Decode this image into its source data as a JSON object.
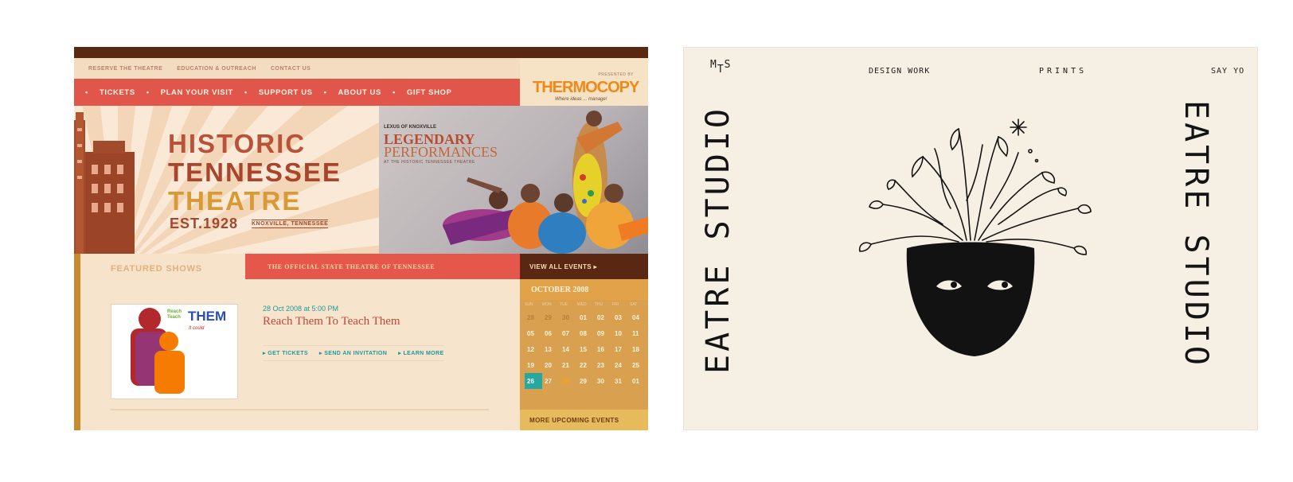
{
  "left_site": {
    "utility_links": [
      "RESERVE THE THEATRE",
      "EDUCATION & OUTREACH",
      "CONTACT US"
    ],
    "nav": [
      "TICKETS",
      "PLAN YOUR VISIT",
      "SUPPORT US",
      "ABOUT US",
      "GIFT SHOP"
    ],
    "sponsor": {
      "presented_by": "PRESENTED BY",
      "name": "THERMOCOPY",
      "tagline": "Where ideas ... manage!"
    },
    "hero": {
      "line1": "HISTORIC",
      "line2": "TENNESSEE",
      "line3": "THEATRE",
      "est": "EST.1928",
      "city": "KNOXVILLE, TENNESSEE"
    },
    "promo": {
      "sponsor": "LEXUS OF KNOXVILLE",
      "line1": "LEGENDARY",
      "line2": "PERFORMANCES",
      "line3": "AT THE HISTORIC TENNESSEE THEATRE"
    },
    "featured_label": "FEATURED SHOWS",
    "state_banner": "THE OFFICIAL STATE THEATRE OF TENNESSEE",
    "view_all": "VIEW ALL EVENTS ▸",
    "show": {
      "date": "28 Oct 2008 at 5:00 PM",
      "title": "Reach Them To Teach Them",
      "thumb_reach": "Reach",
      "thumb_teach": "Teach",
      "thumb_them": "THEM",
      "thumb_sub": "It could",
      "actions": [
        "▸ GET TICKETS",
        "▸ SEND AN INVITATION",
        "▸ LEARN MORE"
      ]
    },
    "calendar": {
      "month": "OCTOBER 2008",
      "dows": [
        "SUN",
        "MON",
        "TUE",
        "WED",
        "THU",
        "FRI",
        "SAT"
      ],
      "days": [
        "28",
        "29",
        "30",
        "01",
        "02",
        "03",
        "04",
        "05",
        "06",
        "07",
        "08",
        "09",
        "10",
        "11",
        "12",
        "13",
        "14",
        "15",
        "16",
        "17",
        "18",
        "19",
        "20",
        "21",
        "22",
        "23",
        "24",
        "25",
        "26",
        "27",
        "28",
        "29",
        "30",
        "31",
        "01"
      ],
      "more": "MORE UPCOMING EVENTS"
    }
  },
  "right_site": {
    "logo": "MTS",
    "nav": [
      "DESIGN WORK",
      "PRINTS",
      "SAY YO"
    ],
    "vertical_left": "EATRE STUDIO",
    "vertical_right": "EATRE STUDIO"
  }
}
